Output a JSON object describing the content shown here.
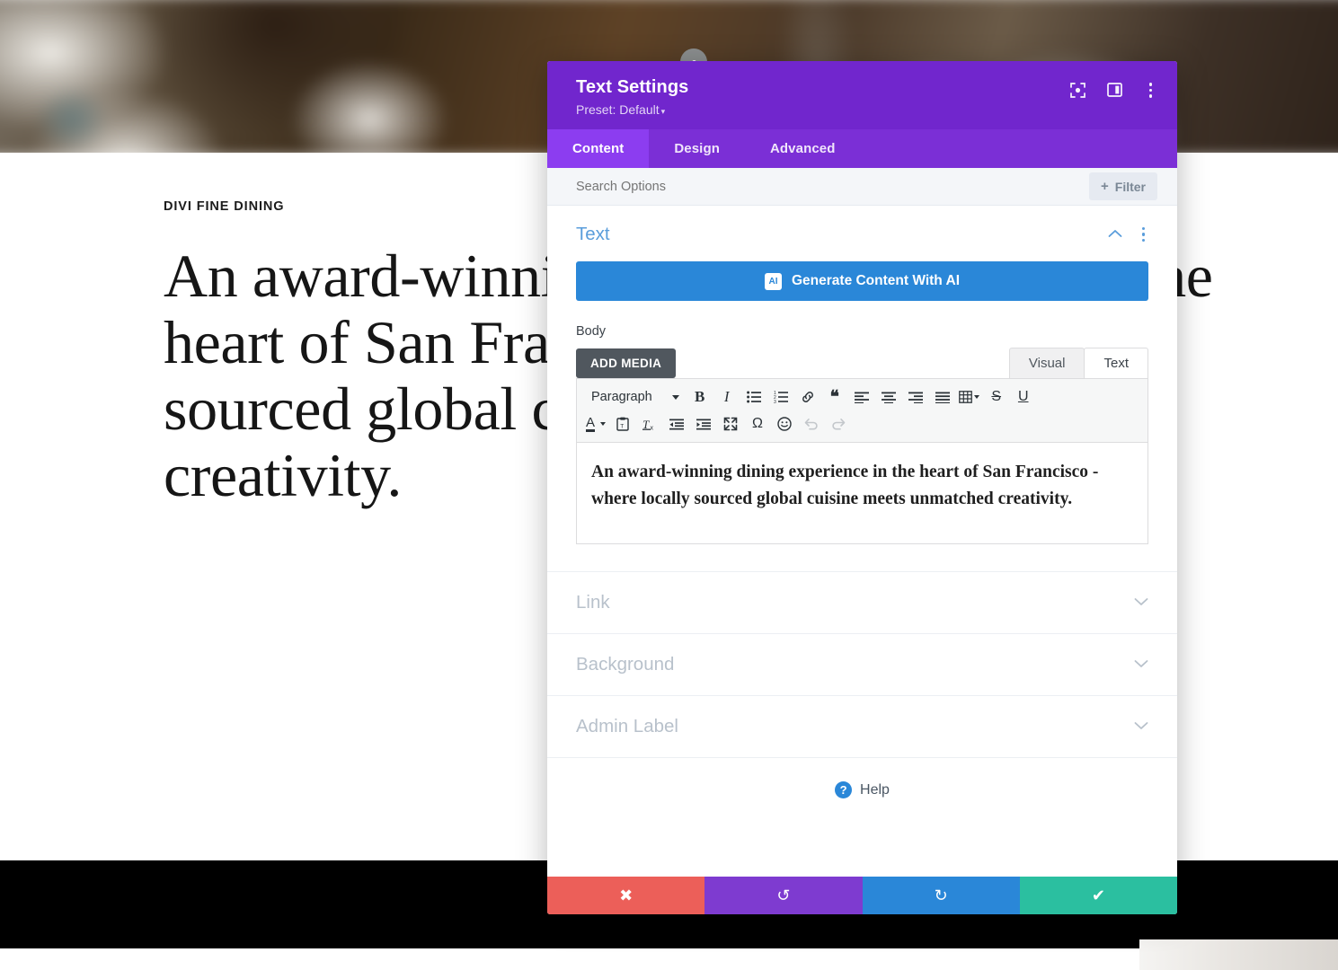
{
  "background_page": {
    "eyebrow": "DIVI FINE DINING",
    "heading": "An award-winning dining experience in the heart of San Francisco - where locally sourced global cuisine meets unmatched creativity."
  },
  "modal": {
    "title": "Text Settings",
    "preset_label": "Preset: Default",
    "preset_caret": "▾",
    "header_icons": [
      {
        "name": "focus-module-icon"
      },
      {
        "name": "panel-layout-icon"
      },
      {
        "name": "more-options-icon"
      }
    ],
    "tabs": [
      {
        "label": "Content",
        "active": true
      },
      {
        "label": "Design",
        "active": false
      },
      {
        "label": "Advanced",
        "active": false
      }
    ],
    "search": {
      "placeholder": "Search Options",
      "value": ""
    },
    "filter_button": {
      "plus": "+",
      "label": "Filter"
    },
    "section": {
      "title": "Text",
      "collapse_caret": "⌃"
    },
    "ai_button": {
      "badge": "AI",
      "label": "Generate Content With AI"
    },
    "body_field": {
      "label": "Body",
      "add_media_label": "ADD MEDIA",
      "editor_tabs": [
        {
          "label": "Visual",
          "active": false
        },
        {
          "label": "Text",
          "active": true
        }
      ],
      "toolbar_row1": [
        {
          "name": "paragraph-format-select",
          "label": "Paragraph",
          "type": "select"
        },
        {
          "name": "bold-button",
          "glyph": "B",
          "style": "bold-serif"
        },
        {
          "name": "italic-button",
          "glyph": "I",
          "style": "italic-serif"
        },
        {
          "name": "bulleted-list-button",
          "glyph": "ul"
        },
        {
          "name": "numbered-list-button",
          "glyph": "ol"
        },
        {
          "name": "insert-link-button",
          "glyph": "link"
        },
        {
          "name": "blockquote-button",
          "glyph": "❝"
        },
        {
          "name": "align-left-button",
          "glyph": "align-left"
        },
        {
          "name": "align-center-button",
          "glyph": "align-center"
        },
        {
          "name": "align-right-button",
          "glyph": "align-right"
        },
        {
          "name": "align-justify-button",
          "glyph": "align-justify"
        },
        {
          "name": "table-button",
          "glyph": "table",
          "type": "split"
        },
        {
          "name": "strikethrough-button",
          "glyph": "S"
        },
        {
          "name": "underline-button",
          "glyph": "U"
        }
      ],
      "toolbar_row2": [
        {
          "name": "text-color-button",
          "glyph": "A",
          "type": "split"
        },
        {
          "name": "paste-as-text-button",
          "glyph": "clipboard"
        },
        {
          "name": "clear-formatting-button",
          "glyph": "Tx"
        },
        {
          "name": "outdent-button",
          "glyph": "outdent"
        },
        {
          "name": "indent-button",
          "glyph": "indent"
        },
        {
          "name": "fullscreen-button",
          "glyph": "expand"
        },
        {
          "name": "special-character-button",
          "glyph": "Ω"
        },
        {
          "name": "emoji-button",
          "glyph": "☺"
        },
        {
          "name": "undo-button",
          "glyph": "undo",
          "disabled": true
        },
        {
          "name": "redo-button",
          "glyph": "redo",
          "disabled": true
        }
      ],
      "content": "An award-winning dining experience in the heart of San Francisco - where locally sourced global cuisine meets unmatched creativity."
    },
    "accordions": [
      {
        "label": "Link",
        "caret": "⌄"
      },
      {
        "label": "Background",
        "caret": "⌄"
      },
      {
        "label": "Admin Label",
        "caret": "⌄"
      }
    ],
    "help": {
      "badge": "?",
      "label": "Help"
    },
    "footer_buttons": [
      {
        "name": "cancel-button",
        "glyph": "✖",
        "color": "#ec5f59"
      },
      {
        "name": "undo-button",
        "glyph": "↺",
        "color": "#7e3bd0"
      },
      {
        "name": "redo-button",
        "glyph": "↻",
        "color": "#2a87d8"
      },
      {
        "name": "save-button",
        "glyph": "✔",
        "color": "#2bbfa0"
      }
    ]
  },
  "colors": {
    "header_purple": "#7126cd",
    "tabbar_purple": "#7b2fd6",
    "tab_active_purple": "#8c3df0",
    "accent_blue": "#2a87d8",
    "section_title_blue": "#5a9ddb",
    "cancel_red": "#ec5f59",
    "undo_purple": "#7e3bd0",
    "redo_blue": "#2a87d8",
    "save_teal": "#2bbfa0"
  }
}
